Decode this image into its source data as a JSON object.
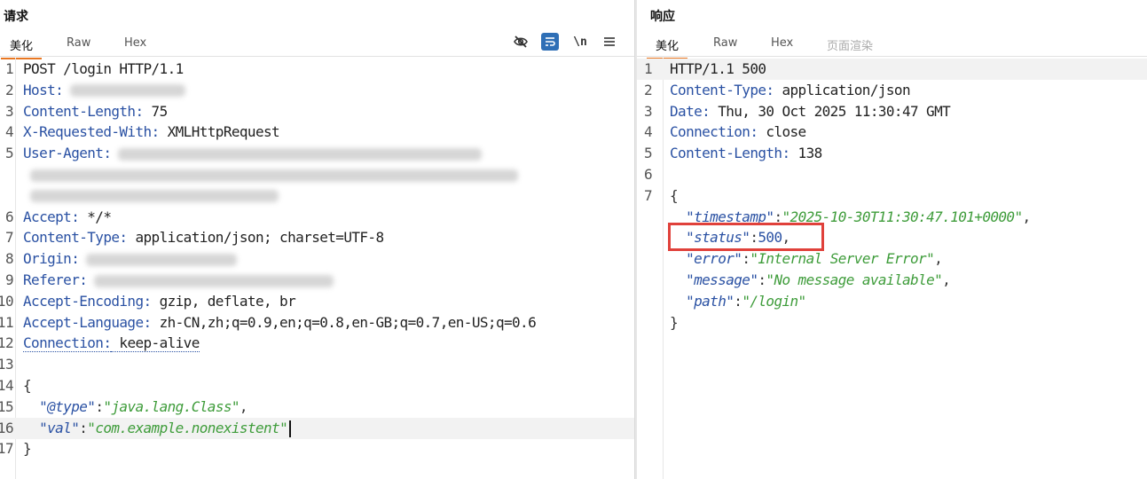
{
  "request": {
    "title": "请求",
    "tabs": [
      "美化",
      "Raw",
      "Hex"
    ],
    "active_tab": "美化",
    "tools": [
      "eye-slash-icon",
      "wrap-icon",
      "newline-icon",
      "menu-icon"
    ],
    "lines": [
      {
        "n": "1",
        "parts": [
          {
            "t": "POST /login HTTP/1.1",
            "c": "hval"
          }
        ]
      },
      {
        "n": "2",
        "parts": [
          {
            "t": "Host:",
            "c": "hkey"
          }
        ],
        "blur": [
          130
        ]
      },
      {
        "n": "3",
        "parts": [
          {
            "t": "Content-Length:",
            "c": "hkey"
          },
          {
            "t": " 75",
            "c": "hval"
          }
        ]
      },
      {
        "n": "4",
        "parts": [
          {
            "t": "X-Requested-With:",
            "c": "hkey"
          },
          {
            "t": " XMLHttpRequest",
            "c": "hval"
          }
        ]
      },
      {
        "n": "5",
        "parts": [
          {
            "t": "User-Agent:",
            "c": "hkey"
          }
        ],
        "blur": [
          410
        ]
      },
      {
        "n": "",
        "parts": [],
        "blur": [
          550
        ]
      },
      {
        "n": "",
        "parts": [],
        "blur": [
          280
        ]
      },
      {
        "n": "6",
        "parts": [
          {
            "t": "Accept:",
            "c": "hkey"
          },
          {
            "t": " */*",
            "c": "hval"
          }
        ]
      },
      {
        "n": "7",
        "parts": [
          {
            "t": "Content-Type:",
            "c": "hkey"
          },
          {
            "t": " application/json; charset=UTF-8",
            "c": "hval"
          }
        ]
      },
      {
        "n": "8",
        "parts": [
          {
            "t": "Origin:",
            "c": "hkey"
          }
        ],
        "blur": [
          170
        ]
      },
      {
        "n": "9",
        "parts": [
          {
            "t": "Referer:",
            "c": "hkey"
          }
        ],
        "blur": [
          270
        ]
      },
      {
        "n": "10",
        "parts": [
          {
            "t": "Accept-Encoding:",
            "c": "hkey"
          },
          {
            "t": " gzip, deflate, br",
            "c": "hval"
          }
        ]
      },
      {
        "n": "11",
        "parts": [
          {
            "t": "Accept-Language:",
            "c": "hkey"
          },
          {
            "t": " zh-CN,zh;q=0.9,en;q=0.8,en-GB;q=0.7,en-US;q=0.6",
            "c": "hval"
          }
        ]
      },
      {
        "n": "12",
        "parts": [
          {
            "t": "Connection:",
            "c": "hkey dotted"
          },
          {
            "t": " keep-alive",
            "c": "hval dotted"
          }
        ]
      },
      {
        "n": "13",
        "parts": []
      },
      {
        "n": "14",
        "parts": [
          {
            "t": "{",
            "c": "punct"
          }
        ]
      },
      {
        "n": "15",
        "parts": [
          {
            "t": "  ",
            "c": "punct"
          },
          {
            "t": "\"@type\"",
            "c": "jkey"
          },
          {
            "t": ":",
            "c": "punct"
          },
          {
            "t": "\"java.lang.Class\"",
            "c": "jstr"
          },
          {
            "t": ",",
            "c": "punct"
          }
        ]
      },
      {
        "n": "16",
        "parts": [
          {
            "t": "  ",
            "c": "punct"
          },
          {
            "t": "\"val\"",
            "c": "jkey"
          },
          {
            "t": ":",
            "c": "punct"
          },
          {
            "t": "\"com.example.nonexistent\"",
            "c": "jstr"
          }
        ],
        "caret": true,
        "highlight": true
      },
      {
        "n": "17",
        "parts": [
          {
            "t": "}",
            "c": "punct"
          }
        ]
      }
    ]
  },
  "response": {
    "title": "响应",
    "tabs": [
      "美化",
      "Raw",
      "Hex",
      "页面渲染"
    ],
    "active_tab": "美化",
    "lines": [
      {
        "n": "1",
        "parts": [
          {
            "t": "HTTP/1.1 500",
            "c": "hval"
          }
        ],
        "highlight": true
      },
      {
        "n": "2",
        "parts": [
          {
            "t": "Content-Type:",
            "c": "hkey"
          },
          {
            "t": " application/json",
            "c": "hval"
          }
        ]
      },
      {
        "n": "3",
        "parts": [
          {
            "t": "Date:",
            "c": "hkey"
          },
          {
            "t": " Thu, 30 Oct 2025 11:30:47 GMT",
            "c": "hval"
          }
        ]
      },
      {
        "n": "4",
        "parts": [
          {
            "t": "Connection:",
            "c": "hkey"
          },
          {
            "t": " close",
            "c": "hval"
          }
        ]
      },
      {
        "n": "5",
        "parts": [
          {
            "t": "Content-Length:",
            "c": "hkey"
          },
          {
            "t": " 138",
            "c": "hval"
          }
        ]
      },
      {
        "n": "6",
        "parts": []
      },
      {
        "n": "7",
        "parts": [
          {
            "t": "{",
            "c": "punct"
          }
        ]
      },
      {
        "n": "",
        "parts": [
          {
            "t": "  ",
            "c": "punct"
          },
          {
            "t": "\"timestamp\"",
            "c": "jkey"
          },
          {
            "t": ":",
            "c": "punct"
          },
          {
            "t": "\"2025-10-30T11:30:47.101+0000\"",
            "c": "jstr"
          },
          {
            "t": ",",
            "c": "punct"
          }
        ]
      },
      {
        "n": "",
        "parts": [
          {
            "t": "  ",
            "c": "punct"
          },
          {
            "t": "\"status\"",
            "c": "jkey"
          },
          {
            "t": ":",
            "c": "punct"
          },
          {
            "t": "500",
            "c": "jnum"
          },
          {
            "t": ",",
            "c": "punct"
          }
        ]
      },
      {
        "n": "",
        "parts": [
          {
            "t": "  ",
            "c": "punct"
          },
          {
            "t": "\"error\"",
            "c": "jkey"
          },
          {
            "t": ":",
            "c": "punct"
          },
          {
            "t": "\"Internal Server Error\"",
            "c": "jstr"
          },
          {
            "t": ",",
            "c": "punct"
          }
        ]
      },
      {
        "n": "",
        "parts": [
          {
            "t": "  ",
            "c": "punct"
          },
          {
            "t": "\"message\"",
            "c": "jkey"
          },
          {
            "t": ":",
            "c": "punct"
          },
          {
            "t": "\"No message available\"",
            "c": "jstr"
          },
          {
            "t": ",",
            "c": "punct"
          }
        ]
      },
      {
        "n": "",
        "parts": [
          {
            "t": "  ",
            "c": "punct"
          },
          {
            "t": "\"path\"",
            "c": "jkey"
          },
          {
            "t": ":",
            "c": "punct"
          },
          {
            "t": "\"/login\"",
            "c": "jstr"
          }
        ]
      },
      {
        "n": "",
        "parts": [
          {
            "t": "}",
            "c": "punct"
          }
        ]
      }
    ]
  },
  "colors": {
    "accent": "#e87722",
    "header_key": "#2a51a3",
    "json_string": "#3e9c3a",
    "annotation_box": "#e0413b",
    "active_tool": "#2f6fb6"
  }
}
